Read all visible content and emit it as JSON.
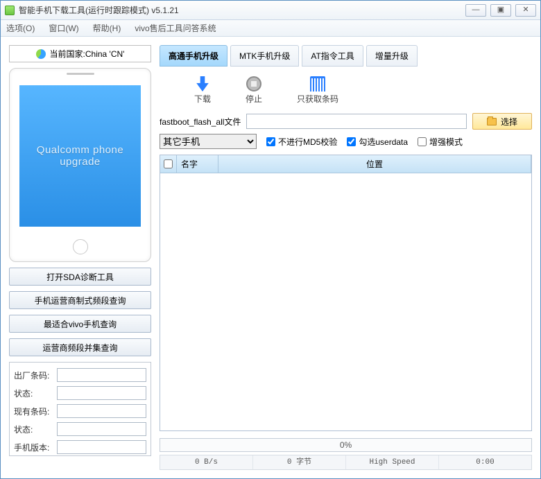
{
  "window": {
    "title": "智能手机下载工具(运行时跟踪模式)  v5.1.21"
  },
  "menu": {
    "options": "选项(O)",
    "window": "窗口(W)",
    "help": "帮助(H)",
    "vivo": "vivo售后工具问答系统"
  },
  "sidebar": {
    "country_label": "当前国家:China 'CN'",
    "phone_text": "Qualcomm phone upgrade",
    "buttons": {
      "sda": "打开SDA诊断工具",
      "carrier_band": "手机运营商制式频段查询",
      "vivo_search": "最适合vivo手机查询",
      "band_collect": "运营商频段并集查询"
    },
    "fields": {
      "factory_barcode": "出厂条码:",
      "status1": "状态:",
      "current_barcode": "现有条码:",
      "status2": "状态:",
      "phone_ver": "手机版本:"
    }
  },
  "tabs": {
    "qualcomm": "高通手机升级",
    "mtk": "MTK手机升级",
    "at": "AT指令工具",
    "incremental": "增量升级"
  },
  "actions": {
    "download": "下载",
    "stop": "停止",
    "barcode_only": "只获取条码"
  },
  "file": {
    "label": "fastboot_flash_all文件",
    "value": "",
    "choose": "选择"
  },
  "options": {
    "phone_type": "其它手机",
    "no_md5": "不进行MD5校验",
    "check_userdata": "勾选userdata",
    "enhanced": "增强模式"
  },
  "table": {
    "col_name": "名字",
    "col_location": "位置"
  },
  "progress": {
    "text": "0%"
  },
  "status": {
    "speed": "0 B/s",
    "bytes": "0 字节",
    "mode": "High Speed",
    "time": "0:00"
  }
}
